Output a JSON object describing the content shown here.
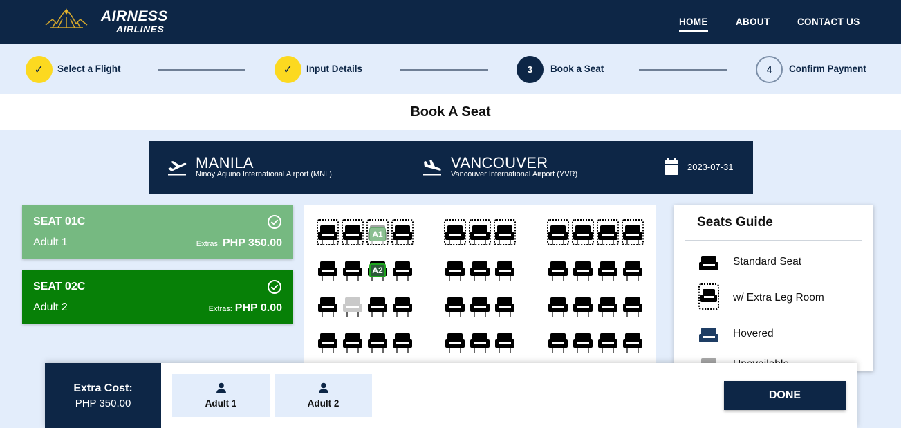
{
  "header": {
    "brand_line1": "AIRNESS",
    "brand_line2": "AIRLINES",
    "nav": [
      {
        "label": "HOME",
        "active": true
      },
      {
        "label": "ABOUT",
        "active": false
      },
      {
        "label": "CONTACT US",
        "active": false
      }
    ]
  },
  "stepper": {
    "steps": [
      {
        "number": "✓",
        "label": "Select a Flight",
        "state": "done"
      },
      {
        "number": "✓",
        "label": "Input Details",
        "state": "done"
      },
      {
        "number": "3",
        "label": "Book a Seat",
        "state": "current"
      },
      {
        "number": "4",
        "label": "Confirm Payment",
        "state": "todo"
      }
    ]
  },
  "page_title": "Book A Seat",
  "route": {
    "origin_city": "MANILA",
    "origin_airport": "Ninoy Aquino International Airport (MNL)",
    "dest_city": "VANCOUVER",
    "dest_airport": "Vancouver International Airport (YVR)",
    "date": "2023-07-31"
  },
  "selected_seats": [
    {
      "seat": "SEAT 01C",
      "passenger": "Adult 1",
      "extras_label": "Extras:",
      "extras_value": "PHP 350.00",
      "color": "#76b981"
    },
    {
      "seat": "SEAT 02C",
      "passenger": "Adult 2",
      "extras_label": "Extras:",
      "extras_value": "PHP 0.00",
      "color": "#078007"
    }
  ],
  "seat_tags": {
    "a1": "A1",
    "a2": "A2"
  },
  "seats_guide": {
    "title": "Seats Guide",
    "items": [
      {
        "label": "Standard Seat",
        "icon": "seat-icon"
      },
      {
        "label": "w/ Extra Leg Room",
        "icon": "extra-legroom-seat-icon"
      },
      {
        "label": "Hovered",
        "icon": "hovered-seat-icon"
      },
      {
        "label": "Unavailable",
        "icon": "unavailable-seat-icon"
      }
    ]
  },
  "bottom_bar": {
    "extra_cost_label": "Extra Cost:",
    "extra_cost_value": "PHP 350.00",
    "passengers": [
      "Adult 1",
      "Adult 2"
    ],
    "done_label": "DONE"
  },
  "colors": {
    "navy": "#0d2646",
    "yellow": "#fcd920",
    "light_green": "#76b981",
    "green": "#078007",
    "background": "#e3edfb"
  }
}
